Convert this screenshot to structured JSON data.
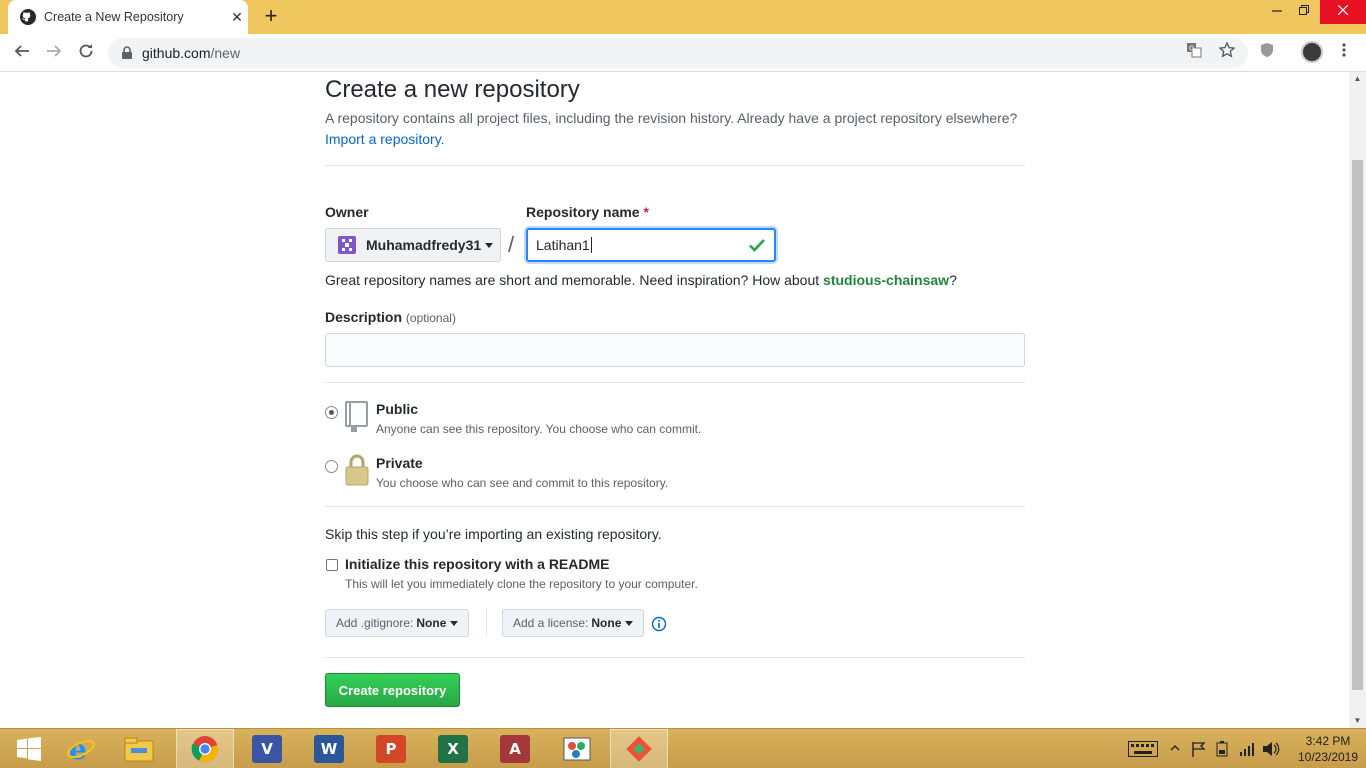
{
  "browser": {
    "tab_title": "Create a New Repository",
    "url_host": "github.com",
    "url_path": "/new",
    "new_tab_symbol": "+",
    "tab_close_symbol": "✕"
  },
  "page": {
    "title": "Create a new repository",
    "intro": "A repository contains all project files, including the revision history. Already have a project repository elsewhere?",
    "import_link": "Import a repository.",
    "owner_label": "Owner",
    "owner_value": "Muhamadfredy31",
    "repo_name_label": "Repository name",
    "required_mark": "*",
    "slash": "/",
    "repo_name_value": "Latihan1",
    "hint_prefix": "Great repository names are short and memorable. Need inspiration? How about",
    "hint_suggestion": "studious-chainsaw",
    "hint_suffix": "?",
    "description_label": "Description",
    "description_optional": "(optional)",
    "description_value": "",
    "visibility": [
      {
        "title": "Public",
        "note": "Anyone can see this repository. You choose who can commit.",
        "selected": true
      },
      {
        "title": "Private",
        "note": "You choose who can see and commit to this repository.",
        "selected": false
      }
    ],
    "skip_text": "Skip this step if you’re importing an existing repository.",
    "readme_title": "Initialize this repository with a README",
    "readme_note": "This will let you immediately clone the repository to your computer.",
    "readme_checked": false,
    "gitignore_label": "Add .gitignore:",
    "gitignore_value": "None",
    "license_label": "Add a license:",
    "license_value": "None",
    "create_button": "Create repository",
    "colors": {
      "accent_link": "#0366d6",
      "success_green": "#28a745",
      "suggestion_green": "#22863a",
      "required_red": "#cb2431"
    }
  },
  "taskbar": {
    "apps": [
      "windows-start",
      "internet-explorer",
      "file-explorer",
      "chrome",
      "visio",
      "word",
      "powerpoint",
      "excel",
      "access",
      "paint-app",
      "git-app"
    ],
    "app_letters": {
      "visio": "V",
      "word": "W",
      "powerpoint": "P",
      "excel": "X",
      "access": "A"
    },
    "time": "3:42 PM",
    "date": "10/23/2019"
  }
}
